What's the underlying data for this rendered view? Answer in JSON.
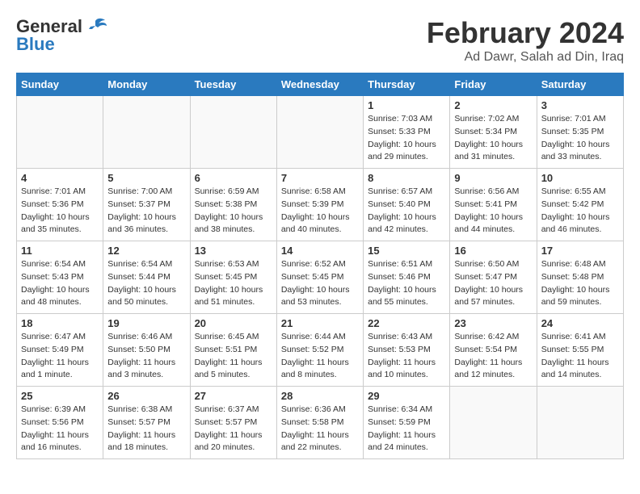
{
  "header": {
    "logo_general": "General",
    "logo_blue": "Blue",
    "month_title": "February 2024",
    "location": "Ad Dawr, Salah ad Din, Iraq"
  },
  "days_of_week": [
    "Sunday",
    "Monday",
    "Tuesday",
    "Wednesday",
    "Thursday",
    "Friday",
    "Saturday"
  ],
  "weeks": [
    [
      {
        "day": "",
        "info": ""
      },
      {
        "day": "",
        "info": ""
      },
      {
        "day": "",
        "info": ""
      },
      {
        "day": "",
        "info": ""
      },
      {
        "day": "1",
        "info": "Sunrise: 7:03 AM\nSunset: 5:33 PM\nDaylight: 10 hours\nand 29 minutes."
      },
      {
        "day": "2",
        "info": "Sunrise: 7:02 AM\nSunset: 5:34 PM\nDaylight: 10 hours\nand 31 minutes."
      },
      {
        "day": "3",
        "info": "Sunrise: 7:01 AM\nSunset: 5:35 PM\nDaylight: 10 hours\nand 33 minutes."
      }
    ],
    [
      {
        "day": "4",
        "info": "Sunrise: 7:01 AM\nSunset: 5:36 PM\nDaylight: 10 hours\nand 35 minutes."
      },
      {
        "day": "5",
        "info": "Sunrise: 7:00 AM\nSunset: 5:37 PM\nDaylight: 10 hours\nand 36 minutes."
      },
      {
        "day": "6",
        "info": "Sunrise: 6:59 AM\nSunset: 5:38 PM\nDaylight: 10 hours\nand 38 minutes."
      },
      {
        "day": "7",
        "info": "Sunrise: 6:58 AM\nSunset: 5:39 PM\nDaylight: 10 hours\nand 40 minutes."
      },
      {
        "day": "8",
        "info": "Sunrise: 6:57 AM\nSunset: 5:40 PM\nDaylight: 10 hours\nand 42 minutes."
      },
      {
        "day": "9",
        "info": "Sunrise: 6:56 AM\nSunset: 5:41 PM\nDaylight: 10 hours\nand 44 minutes."
      },
      {
        "day": "10",
        "info": "Sunrise: 6:55 AM\nSunset: 5:42 PM\nDaylight: 10 hours\nand 46 minutes."
      }
    ],
    [
      {
        "day": "11",
        "info": "Sunrise: 6:54 AM\nSunset: 5:43 PM\nDaylight: 10 hours\nand 48 minutes."
      },
      {
        "day": "12",
        "info": "Sunrise: 6:54 AM\nSunset: 5:44 PM\nDaylight: 10 hours\nand 50 minutes."
      },
      {
        "day": "13",
        "info": "Sunrise: 6:53 AM\nSunset: 5:45 PM\nDaylight: 10 hours\nand 51 minutes."
      },
      {
        "day": "14",
        "info": "Sunrise: 6:52 AM\nSunset: 5:45 PM\nDaylight: 10 hours\nand 53 minutes."
      },
      {
        "day": "15",
        "info": "Sunrise: 6:51 AM\nSunset: 5:46 PM\nDaylight: 10 hours\nand 55 minutes."
      },
      {
        "day": "16",
        "info": "Sunrise: 6:50 AM\nSunset: 5:47 PM\nDaylight: 10 hours\nand 57 minutes."
      },
      {
        "day": "17",
        "info": "Sunrise: 6:48 AM\nSunset: 5:48 PM\nDaylight: 10 hours\nand 59 minutes."
      }
    ],
    [
      {
        "day": "18",
        "info": "Sunrise: 6:47 AM\nSunset: 5:49 PM\nDaylight: 11 hours\nand 1 minute."
      },
      {
        "day": "19",
        "info": "Sunrise: 6:46 AM\nSunset: 5:50 PM\nDaylight: 11 hours\nand 3 minutes."
      },
      {
        "day": "20",
        "info": "Sunrise: 6:45 AM\nSunset: 5:51 PM\nDaylight: 11 hours\nand 5 minutes."
      },
      {
        "day": "21",
        "info": "Sunrise: 6:44 AM\nSunset: 5:52 PM\nDaylight: 11 hours\nand 8 minutes."
      },
      {
        "day": "22",
        "info": "Sunrise: 6:43 AM\nSunset: 5:53 PM\nDaylight: 11 hours\nand 10 minutes."
      },
      {
        "day": "23",
        "info": "Sunrise: 6:42 AM\nSunset: 5:54 PM\nDaylight: 11 hours\nand 12 minutes."
      },
      {
        "day": "24",
        "info": "Sunrise: 6:41 AM\nSunset: 5:55 PM\nDaylight: 11 hours\nand 14 minutes."
      }
    ],
    [
      {
        "day": "25",
        "info": "Sunrise: 6:39 AM\nSunset: 5:56 PM\nDaylight: 11 hours\nand 16 minutes."
      },
      {
        "day": "26",
        "info": "Sunrise: 6:38 AM\nSunset: 5:57 PM\nDaylight: 11 hours\nand 18 minutes."
      },
      {
        "day": "27",
        "info": "Sunrise: 6:37 AM\nSunset: 5:57 PM\nDaylight: 11 hours\nand 20 minutes."
      },
      {
        "day": "28",
        "info": "Sunrise: 6:36 AM\nSunset: 5:58 PM\nDaylight: 11 hours\nand 22 minutes."
      },
      {
        "day": "29",
        "info": "Sunrise: 6:34 AM\nSunset: 5:59 PM\nDaylight: 11 hours\nand 24 minutes."
      },
      {
        "day": "",
        "info": ""
      },
      {
        "day": "",
        "info": ""
      }
    ]
  ]
}
